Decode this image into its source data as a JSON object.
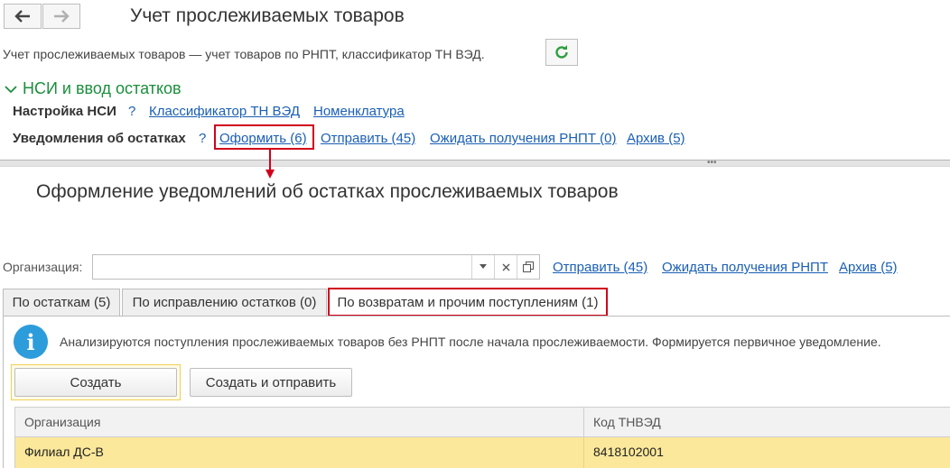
{
  "header": {
    "back_icon": "arrow-left-icon",
    "forward_icon": "arrow-right-icon",
    "title": "Учет прослеживаемых товаров",
    "subtitle": "Учет прослеживаемых товаров — учет товаров по РНПТ, классификатор ТН ВЭД.",
    "refresh_icon": "refresh-icon"
  },
  "section": {
    "title": "НСИ и ввод остатков",
    "nsi_label": "Настройка НСИ",
    "help": "?",
    "classifier_link": "Классификатор ТН ВЭД",
    "nomenclature_link": "Номенклатура",
    "notices_label": "Уведомления об остатках",
    "help2": "?",
    "create_link": "Оформить (6)",
    "send_link": "Отправить (45)",
    "wait_link": "Ожидать получения РНПТ (0)",
    "archive_link": "Архив (5)"
  },
  "form": {
    "title": "Оформление уведомлений об остатках прослеживаемых товаров",
    "org_label": "Организация:",
    "org_value": "",
    "send_link": "Отправить (45)",
    "wait_link": "Ожидать получения РНПТ",
    "archive_link": "Архив (5)",
    "tabs": [
      {
        "label": "По остаткам (5)"
      },
      {
        "label": "По исправлению остатков (0)"
      },
      {
        "label": "По возвратам и прочим поступлениям (1)"
      }
    ],
    "info_text": "Анализируются поступления прослеживаемых товаров без РНПТ после начала прослеживаемости. Формируется первичное уведомление.",
    "create_button": "Создать",
    "create_send_button": "Создать и отправить",
    "table": {
      "columns": [
        "Организация",
        "Код ТНВЭД"
      ],
      "rows": [
        {
          "org": "Филиал ДС-В",
          "code": "8418102001"
        }
      ]
    }
  },
  "colors": {
    "link": "#1a5fb4",
    "section_green": "#1a8f3c",
    "highlight_red": "#d0021b",
    "selected_row": "#fbe89a",
    "info_icon": "#2d9cdb"
  }
}
